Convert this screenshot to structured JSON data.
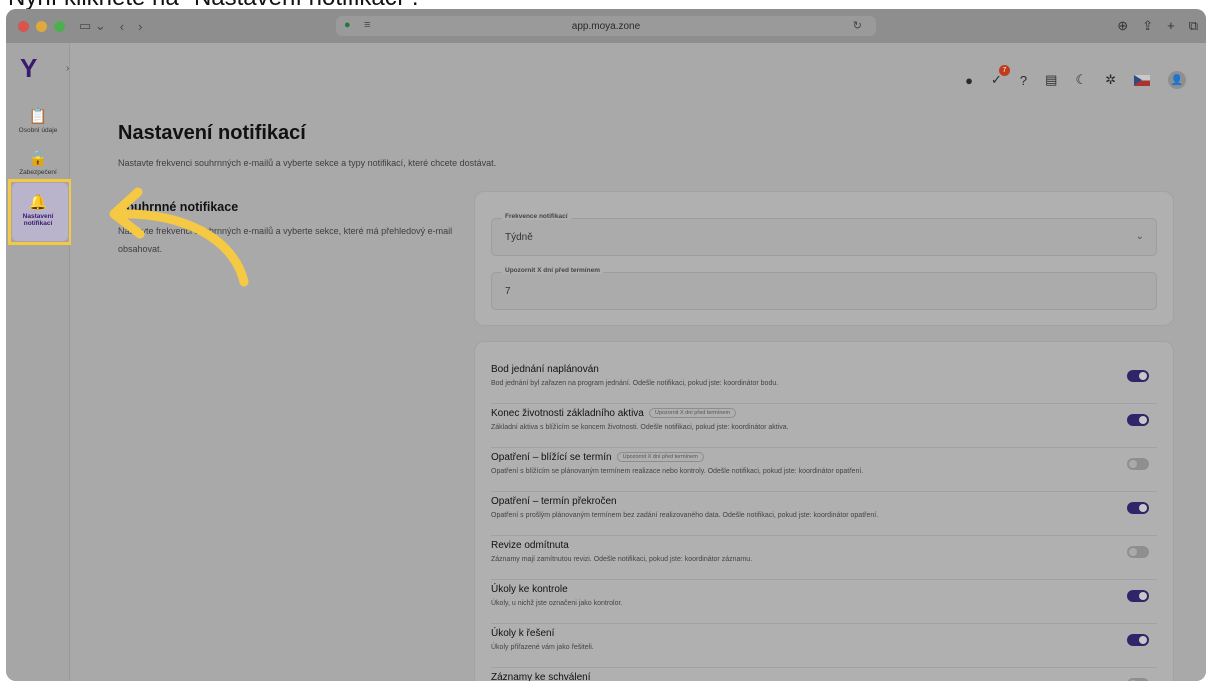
{
  "caption": "Nyní klikněte na \"Nastavení notifikací\".",
  "browser": {
    "url": "app.moya.zone",
    "traffic_colors": [
      "#d9534f",
      "#e0a93b",
      "#4caf50"
    ]
  },
  "sidebar": {
    "logo": "Y",
    "items": [
      {
        "label": "Osobní údaje",
        "icon": "clipboard-icon"
      },
      {
        "label": "Zabezpečení",
        "icon": "lock-icon"
      },
      {
        "label": "Nastavení notifikací",
        "icon": "bell-icon",
        "active": true
      }
    ]
  },
  "header": {
    "notification_count": "7",
    "icons": [
      "cookie-icon",
      "tasks-icon",
      "help-icon",
      "news-icon",
      "moon-icon",
      "sparkle-icon",
      "czech-flag-icon",
      "user-avatar-icon"
    ]
  },
  "page": {
    "title": "Nastavení notifikací",
    "subtitle": "Nastavte frekvenci souhrnných e-mailů a vyberte sekce a typy notifikací, které chcete dostávat."
  },
  "summary": {
    "title": "Souhrnné notifikace",
    "description": "Nastavte frekvenci souhrnných e-mailů a vyberte sekce, které má přehledový e-mail obsahovat."
  },
  "frequency": {
    "label": "Frekvence notifikací",
    "value": "Týdně",
    "remind_label": "Upozornit X dní před termínem",
    "remind_value": "7"
  },
  "notifications": [
    {
      "title": "Bod jednání naplánován",
      "tag": "",
      "desc": "Bod jednání byl zařazen na program jednání. Odešle notifikaci, pokud jste: koordinátor bodu.",
      "enabled": true
    },
    {
      "title": "Konec životnosti základního aktiva",
      "tag": "Upozornit X dní před termínem",
      "desc": "Základní aktiva s blížícím se koncem životnosti. Odešle notifikaci, pokud jste: koordinátor aktiva.",
      "enabled": true
    },
    {
      "title": "Opatření – blížící se termín",
      "tag": "Upozornit X dní před termínem",
      "desc": "Opatření s blížícím se plánovaným termínem realizace nebo kontroly. Odešle notifikaci, pokud jste: koordinátor opatření.",
      "enabled": false
    },
    {
      "title": "Opatření – termín překročen",
      "tag": "",
      "desc": "Opatření s prošlým plánovaným termínem bez zadání realizovaného data. Odešle notifikaci, pokud jste: koordinátor opatření.",
      "enabled": true
    },
    {
      "title": "Revize odmítnuta",
      "tag": "",
      "desc": "Záznamy mají zamítnutou revizi. Odešle notifikaci, pokud jste: koordinátor záznamu.",
      "enabled": false
    },
    {
      "title": "Úkoly ke kontrole",
      "tag": "",
      "desc": "Úkoly, u nichž jste označeni jako kontrolor.",
      "enabled": true
    },
    {
      "title": "Úkoly k řešení",
      "tag": "",
      "desc": "Úkoly přiřazené vám jako řešiteli.",
      "enabled": true
    },
    {
      "title": "Záznamy ke schválení",
      "tag": "",
      "desc": "",
      "enabled": false
    }
  ],
  "colors": {
    "accent": "#2f2569",
    "highlight": "#f6c944"
  }
}
